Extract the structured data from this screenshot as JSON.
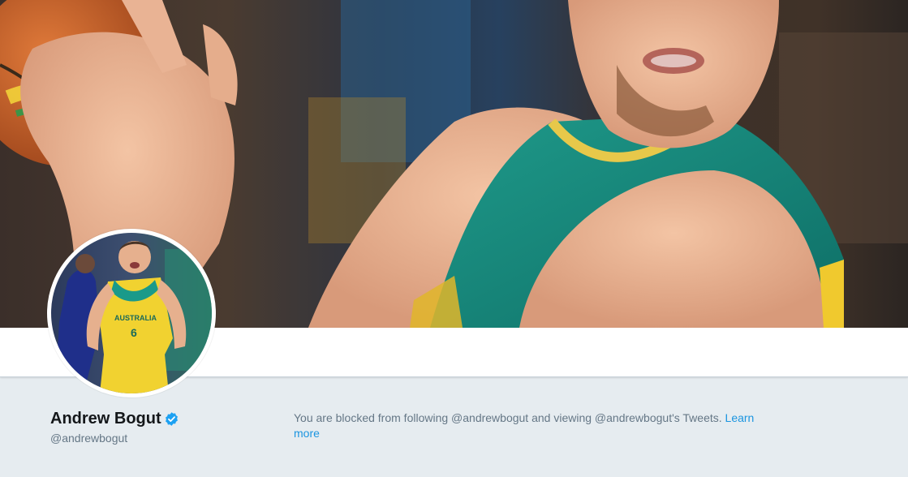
{
  "header": {
    "banner_description_icon": "banner-photo",
    "avatar_icon": "avatar-photo"
  },
  "profile": {
    "name": "Andrew Bogut",
    "screen_name": "@andrewbogut",
    "verified_icon": "verified-badge-icon"
  },
  "blocked_notice": {
    "message": "You are blocked from following @andrewbogut and viewing @andrewbogut's Tweets.",
    "link_text": "Learn more"
  },
  "colors": {
    "background": "#e6ecf0",
    "link": "#1b95e0",
    "verified": "#1da1f2",
    "text_primary": "#14171a",
    "text_secondary": "#657786"
  }
}
